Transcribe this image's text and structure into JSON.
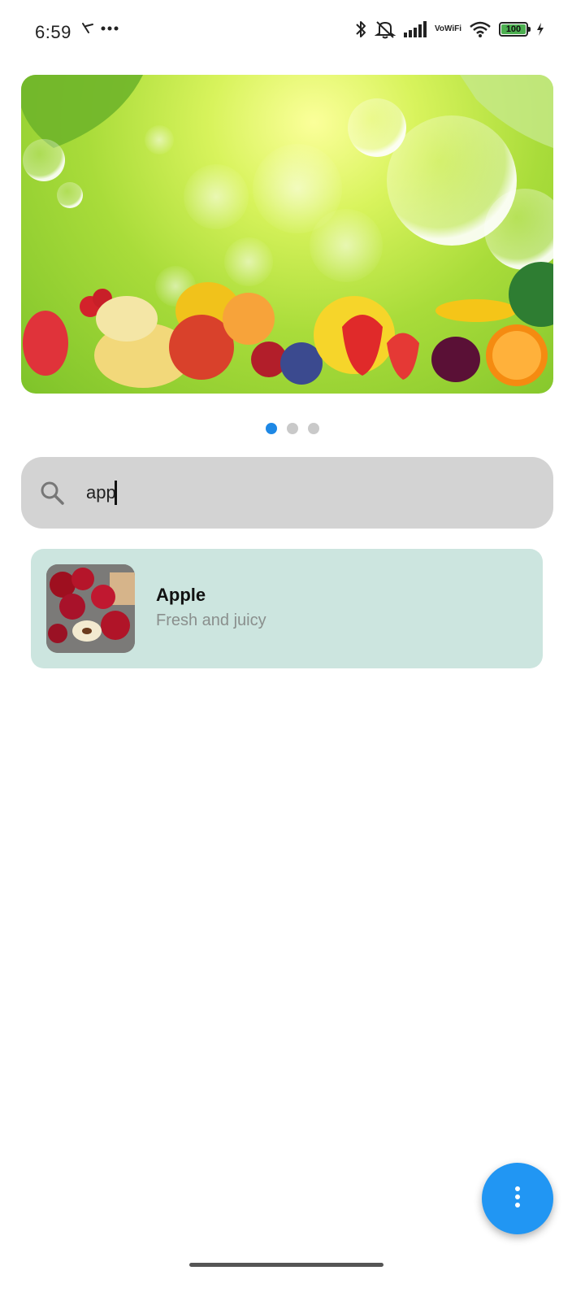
{
  "status_bar": {
    "time": "6:59",
    "battery_level": "100",
    "icons": [
      "notification-check-icon",
      "more-dots-icon",
      "bluetooth-icon",
      "mute-icon",
      "signal-icon",
      "vowifi-icon",
      "wifi-icon",
      "battery-icon",
      "charging-icon"
    ],
    "vowifi_line1": "Vo",
    "vowifi_line2": "WiFi"
  },
  "banner": {
    "subject": "fruits-banner-image",
    "pager": {
      "total": 3,
      "active_index": 0
    }
  },
  "search": {
    "value": "app",
    "icon": "search-icon"
  },
  "results": [
    {
      "title": "Apple",
      "subtitle": "Fresh and juicy",
      "thumbnail": "apples-image"
    }
  ],
  "fab": {
    "icon": "more-vert-icon"
  },
  "colors": {
    "accent": "#2196f3",
    "card_bg": "#cce5df",
    "search_bg": "#d3d3d3",
    "pager_active": "#1e88e5",
    "pager_inactive": "#c9c9c9"
  }
}
